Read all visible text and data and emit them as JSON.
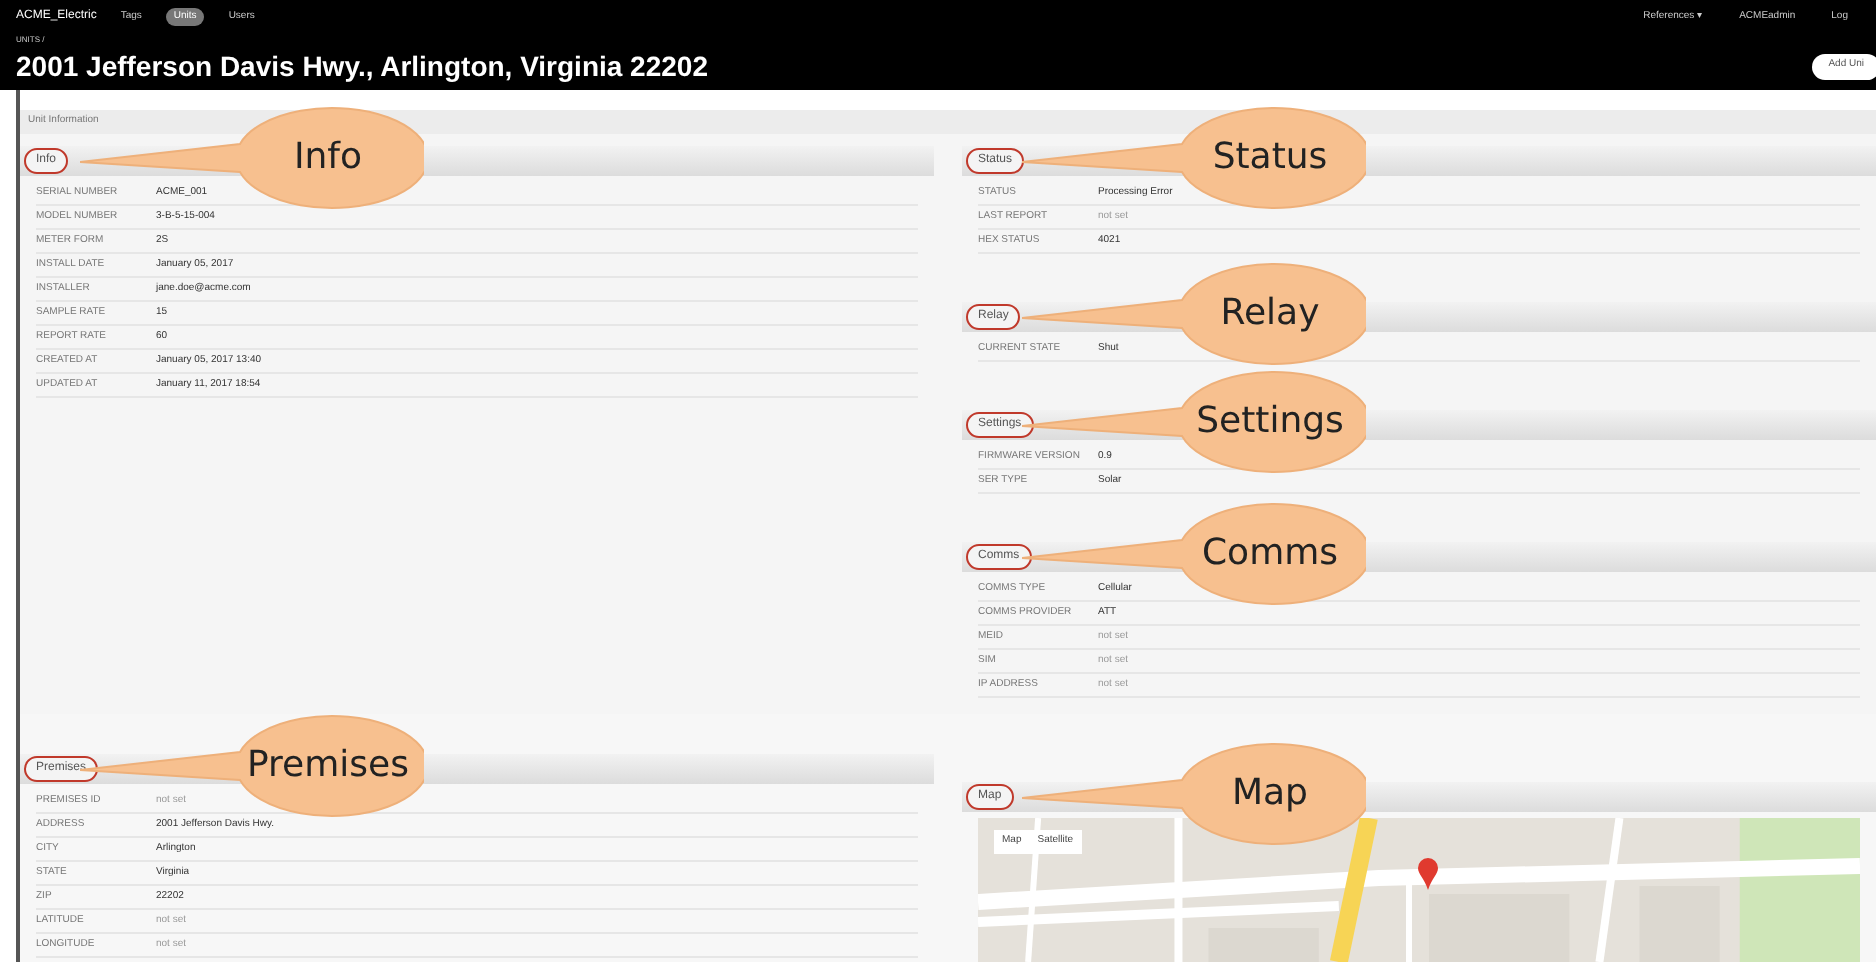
{
  "nav": {
    "brand": "ACME_Electric",
    "links": [
      {
        "label": "Tags",
        "selected": false
      },
      {
        "label": "Units",
        "selected": true
      },
      {
        "label": "Users",
        "selected": false
      }
    ],
    "right": [
      "References ▾",
      "ACMEadmin",
      "Log"
    ]
  },
  "breadcrumb": "UNITS /",
  "title": "2001 Jefferson Davis Hwy., Arlington, Virginia 22202",
  "add_button": "Add Uni",
  "panel_title": "Unit Information",
  "top_left": [
    {
      "kind": "table",
      "label": "Info",
      "callout": "Info",
      "rows": [
        {
          "key": "SERIAL NUMBER",
          "value": "ACME_001",
          "muted": false
        },
        {
          "key": "MODEL NUMBER",
          "value": "3-B-5-15-004",
          "muted": false
        },
        {
          "key": "METER FORM",
          "value": "2S",
          "muted": false
        },
        {
          "key": "INSTALL DATE",
          "value": "January 05, 2017",
          "muted": false
        },
        {
          "key": "INSTALLER",
          "value": "jane.doe@acme.com",
          "muted": false
        },
        {
          "key": "SAMPLE RATE",
          "value": "15",
          "muted": false
        },
        {
          "key": "REPORT RATE",
          "value": "60",
          "muted": false
        },
        {
          "key": "CREATED AT",
          "value": "January 05, 2017 13:40",
          "muted": false
        },
        {
          "key": "UPDATED AT",
          "value": "January 11, 2017 18:54",
          "muted": false
        }
      ]
    }
  ],
  "top_right": [
    {
      "kind": "table",
      "label": "Status",
      "callout": "Status",
      "rows": [
        {
          "key": "STATUS",
          "value": "Processing Error",
          "muted": false
        },
        {
          "key": "LAST REPORT",
          "value": "not set",
          "muted": true
        },
        {
          "key": "HEX STATUS",
          "value": "4021",
          "muted": false
        }
      ]
    },
    {
      "kind": "table",
      "label": "Relay",
      "callout": "Relay",
      "rows": [
        {
          "key": "CURRENT STATE",
          "value": "Shut",
          "muted": false
        }
      ]
    },
    {
      "kind": "table",
      "label": "Settings",
      "callout": "Settings",
      "rows": [
        {
          "key": "FIRMWARE VERSION",
          "value": "0.9",
          "muted": false
        },
        {
          "key": "SER TYPE",
          "value": "Solar",
          "muted": false
        }
      ]
    },
    {
      "kind": "table",
      "label": "Comms",
      "callout": "Comms",
      "rows": [
        {
          "key": "COMMS TYPE",
          "value": "Cellular",
          "muted": false
        },
        {
          "key": "COMMS PROVIDER",
          "value": "ATT",
          "muted": false
        },
        {
          "key": "MEID",
          "value": "not set",
          "muted": true
        },
        {
          "key": "SIM",
          "value": "not set",
          "muted": true
        },
        {
          "key": "IP ADDRESS",
          "value": "not set",
          "muted": true
        }
      ]
    }
  ],
  "bottom_left": [
    {
      "kind": "table",
      "label": "Premises",
      "callout": "Premises",
      "rows": [
        {
          "key": "PREMISES ID",
          "value": "not set",
          "muted": true
        },
        {
          "key": "ADDRESS",
          "value": "2001 Jefferson Davis Hwy.",
          "muted": false
        },
        {
          "key": "CITY",
          "value": "Arlington",
          "muted": false
        },
        {
          "key": "STATE",
          "value": "Virginia",
          "muted": false
        },
        {
          "key": "ZIP",
          "value": "22202",
          "muted": false
        },
        {
          "key": "LATITUDE",
          "value": "not set",
          "muted": true
        },
        {
          "key": "LONGITUDE",
          "value": "not set",
          "muted": true
        }
      ]
    }
  ],
  "bottom_right": [
    {
      "kind": "map",
      "label": "Map",
      "callout": "Map",
      "map_buttons": [
        "Map",
        "Satellite"
      ]
    }
  ]
}
